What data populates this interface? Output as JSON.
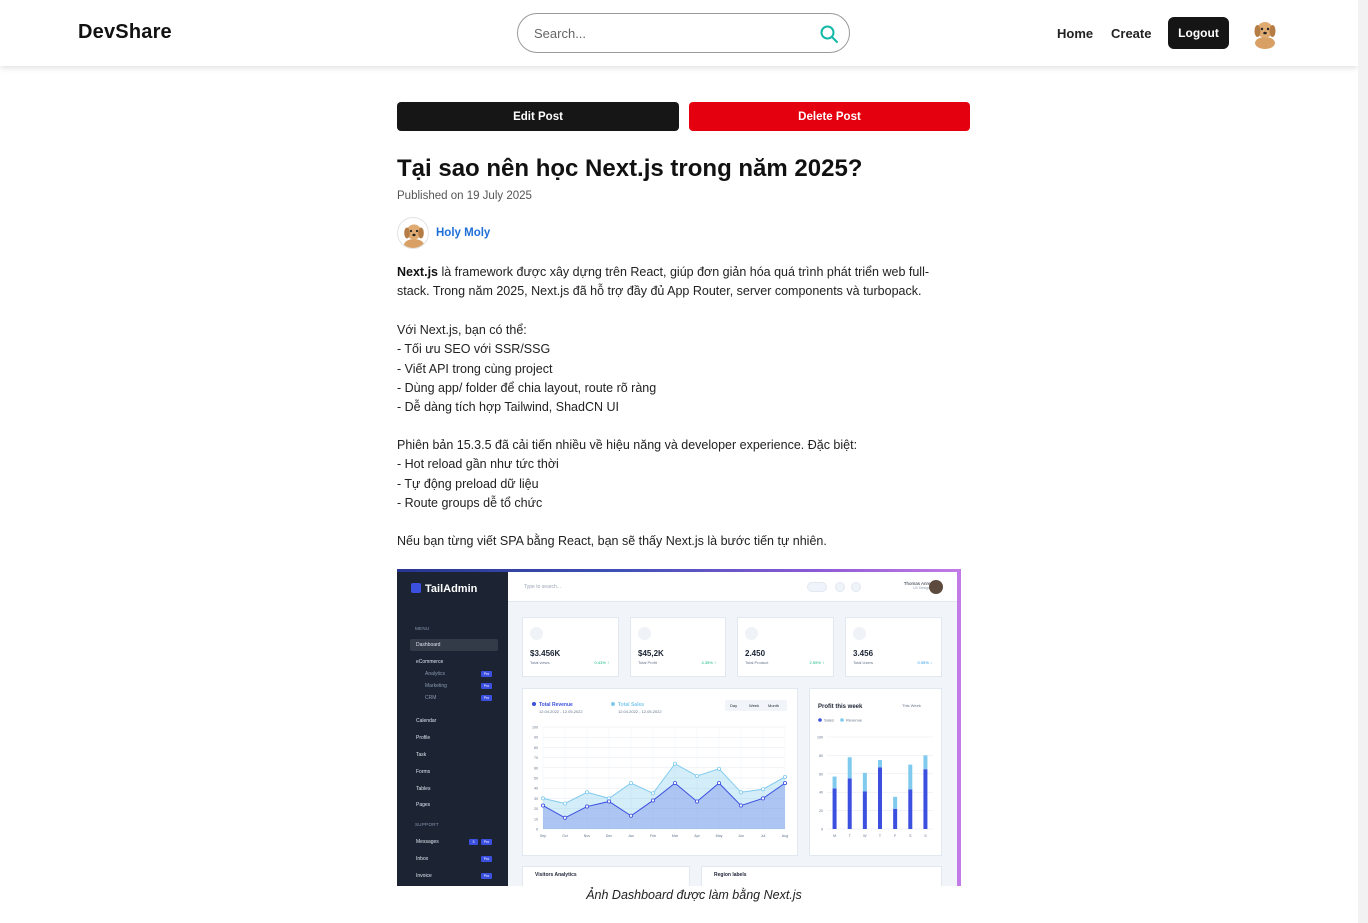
{
  "header": {
    "brand": "DevShare",
    "search_placeholder": "Search...",
    "nav": {
      "home": "Home",
      "create": "Create",
      "logout": "Logout"
    }
  },
  "actions": {
    "edit": "Edit Post",
    "delete": "Delete Post"
  },
  "post": {
    "title": "Tại sao nên học Next.js trong năm 2025?",
    "published": "Published on 19 July 2025",
    "author": "Holy Moly",
    "intro_bold": "Next.js",
    "intro_line1_rest": " là framework được xây dựng trên React, giúp đơn giản hóa quá trình phát triển web full-",
    "intro_line2": "stack. Trong năm 2025, Next.js đã hỗ trợ đầy đủ App Router, server components và turbopack.",
    "with_next": "Với Next.js, bạn có thể:",
    "benefits": [
      "- Tối ưu SEO với SSR/SSG",
      "- Viết API trong cùng project",
      "- Dùng app/ folder để chia layout, route rõ ràng",
      "- Dễ dàng tích hợp Tailwind, ShadCN UI"
    ],
    "version_note": "Phiên bản 15.3.5 đã cải tiến nhiều về hiệu năng và developer experience. Đặc biệt:",
    "features": [
      "- Hot reload gần như tức thời",
      "- Tự động preload dữ liệu",
      "- Route groups dễ tổ chức"
    ],
    "closing": "Nếu bạn từng viết SPA bằng React, bạn sẽ thấy Next.js là bước tiến tự nhiên.",
    "caption": "Ảnh Dashboard được làm bằng Next.js"
  },
  "dashboard_image": {
    "logo": "TailAdmin",
    "search_placeholder": "Type to search...",
    "user_name": "Thomas Anree",
    "user_role": "UX Designer",
    "menu_label": "MENU",
    "support_label": "SUPPORT",
    "menu": [
      "Dashboard",
      "eCommerce",
      "Analytics",
      "Marketing",
      "CRM",
      "Calendar",
      "Profile",
      "Task",
      "Forms",
      "Tables",
      "Pages"
    ],
    "support": [
      "Messages",
      "Inbox",
      "Invoice"
    ],
    "pro_badge": "Pro",
    "messages_count": "3",
    "cards": [
      {
        "value": "$3.456K",
        "label": "Total views",
        "pct": "0.43% ↑"
      },
      {
        "value": "$45,2K",
        "label": "Total Profit",
        "pct": "4.35% ↑"
      },
      {
        "value": "2.450",
        "label": "Total Product",
        "pct": "2.59% ↑"
      },
      {
        "value": "3.456",
        "label": "Total Users",
        "pct": "0.95% ↓"
      }
    ],
    "revenue_legend": {
      "revenue": "Total Revenue",
      "revenue_range": "12.04.2022 - 12.05.2022",
      "sales": "Total Sales",
      "sales_range": "12.04.2022 - 12.05.2022"
    },
    "range_tabs": [
      "Day",
      "Week",
      "Month"
    ],
    "profit_title": "Profit this week",
    "profit_select": "This Week",
    "profit_legend": [
      "Sales",
      "Revenue"
    ],
    "bottom_cards": [
      "Visitors Analytics",
      "Region labels"
    ],
    "colors": {
      "primary": "#3c50e0",
      "secondary": "#80caee",
      "sidebar": "#1c2434"
    }
  },
  "chart_data": [
    {
      "type": "area",
      "title": "",
      "categories": [
        "Sep",
        "Oct",
        "Nov",
        "Dec",
        "Jan",
        "Feb",
        "Mar",
        "Apr",
        "May",
        "Jun",
        "Jul",
        "Aug"
      ],
      "series": [
        {
          "name": "Total Revenue",
          "values": [
            23,
            11,
            22,
            27,
            13,
            28,
            45,
            27,
            45,
            23,
            30,
            45
          ]
        },
        {
          "name": "Total Sales",
          "values": [
            30,
            25,
            36,
            30,
            45,
            35,
            64,
            52,
            59,
            36,
            39,
            51
          ]
        }
      ],
      "yticks": [
        0,
        10,
        20,
        30,
        40,
        50,
        60,
        70,
        80,
        90,
        100
      ],
      "ylim": [
        0,
        100
      ]
    },
    {
      "type": "bar",
      "title": "Profit this week",
      "categories": [
        "M",
        "T",
        "W",
        "T",
        "F",
        "S",
        "S"
      ],
      "series": [
        {
          "name": "Sales",
          "values": [
            44,
            55,
            41,
            67,
            22,
            43,
            65
          ]
        },
        {
          "name": "Revenue",
          "values": [
            13,
            23,
            20,
            8,
            13,
            27,
            15
          ]
        }
      ],
      "yticks": [
        0,
        20,
        40,
        60,
        80,
        100
      ],
      "ylim": [
        0,
        100
      ],
      "stacked": true
    }
  ]
}
